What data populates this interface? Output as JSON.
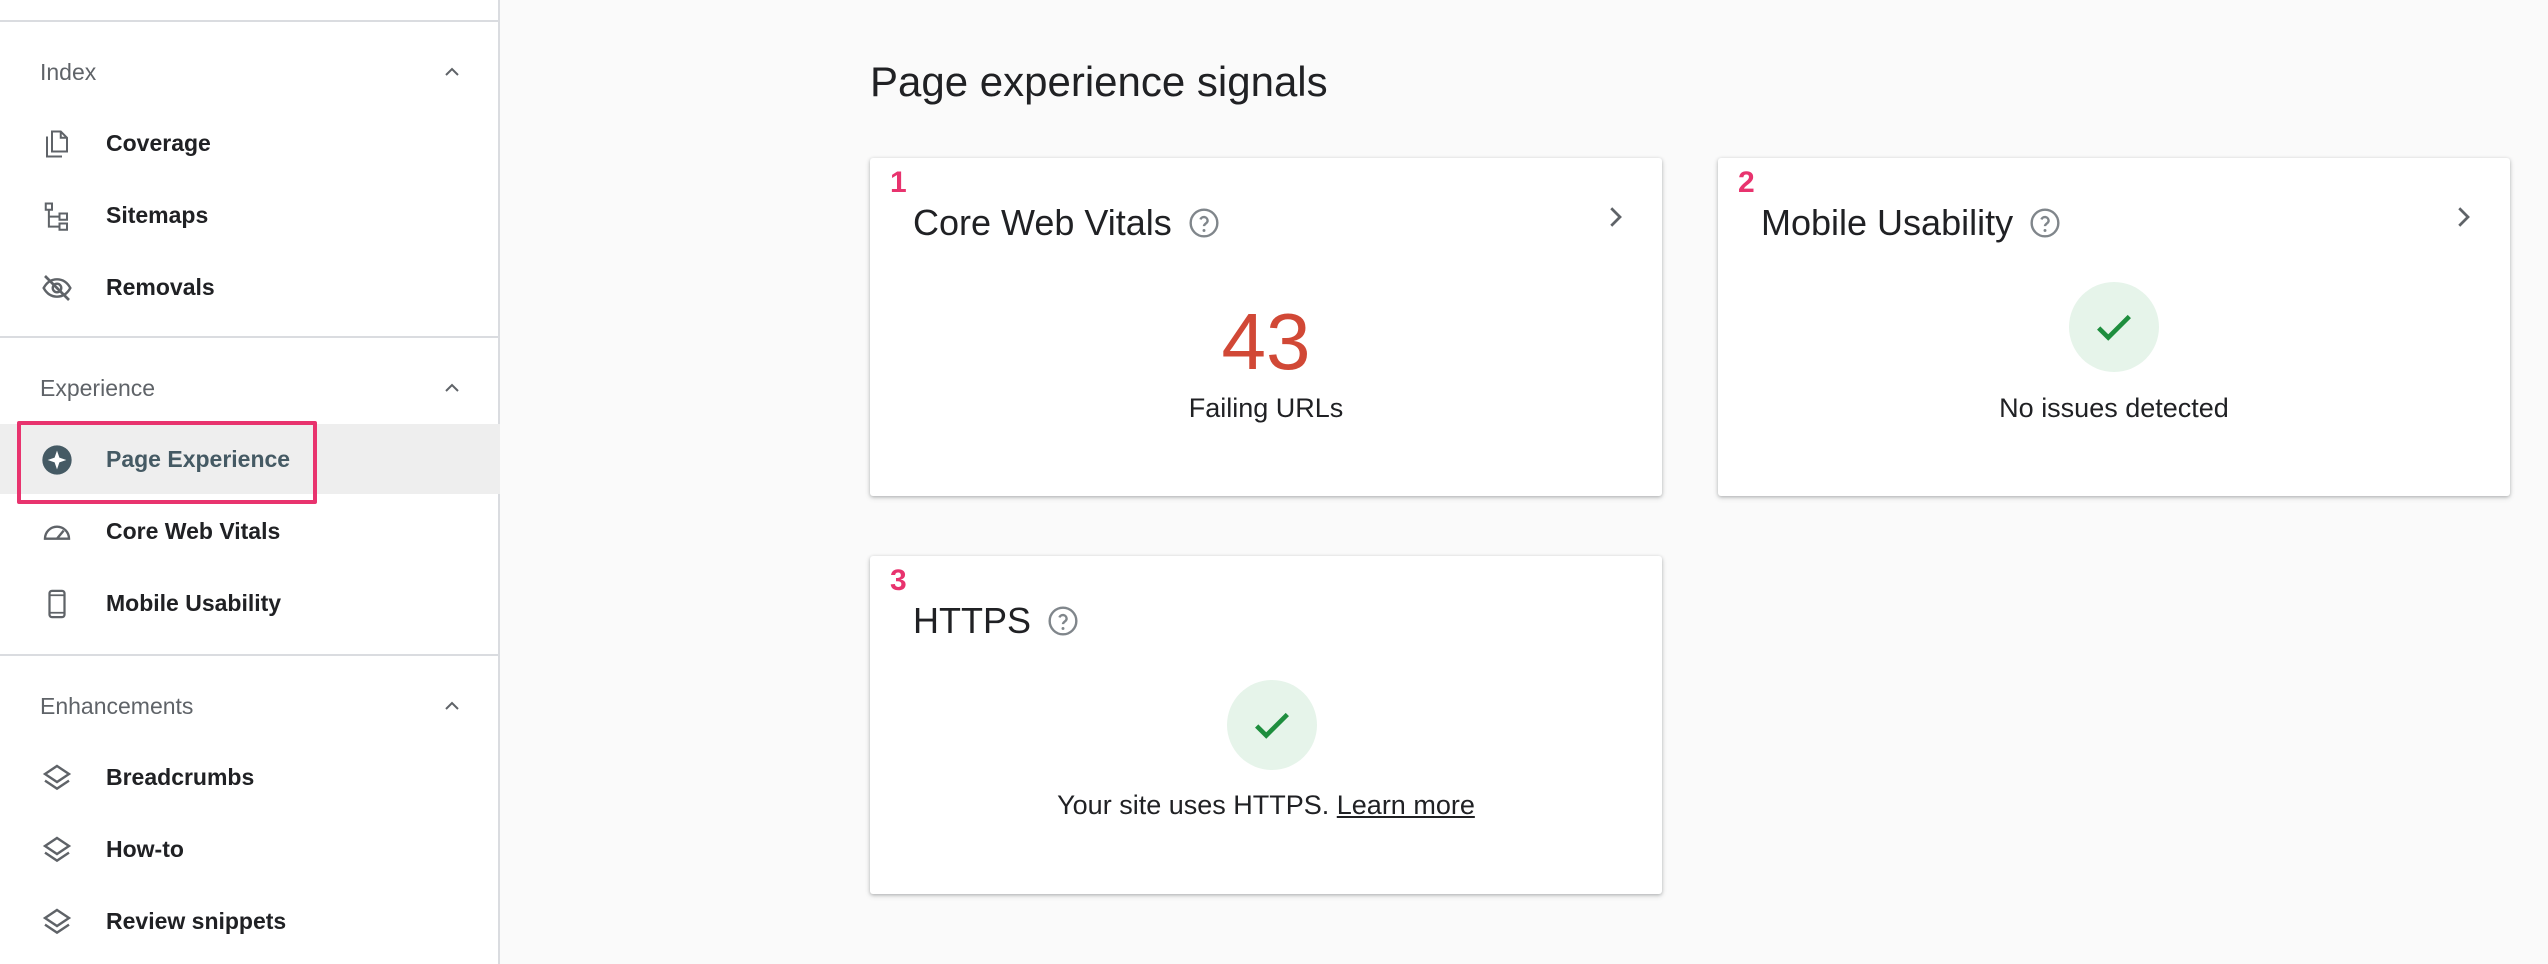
{
  "sidebar": {
    "sections": [
      {
        "label": "Index",
        "items": [
          {
            "label": "Coverage",
            "icon": "coverage-icon"
          },
          {
            "label": "Sitemaps",
            "icon": "sitemap-icon"
          },
          {
            "label": "Removals",
            "icon": "eye-off-icon"
          }
        ]
      },
      {
        "label": "Experience",
        "items": [
          {
            "label": "Page Experience",
            "icon": "page-experience-icon",
            "active": true
          },
          {
            "label": "Core Web Vitals",
            "icon": "speedometer-icon"
          },
          {
            "label": "Mobile Usability",
            "icon": "phone-icon"
          }
        ]
      },
      {
        "label": "Enhancements",
        "items": [
          {
            "label": "Breadcrumbs",
            "icon": "layers-icon"
          },
          {
            "label": "How-to",
            "icon": "layers-icon"
          },
          {
            "label": "Review snippets",
            "icon": "layers-icon"
          }
        ]
      }
    ]
  },
  "main": {
    "title": "Page experience signals",
    "cards": [
      {
        "number": "1",
        "title": "Core Web Vitals",
        "value": "43",
        "label": "Failing URLs"
      },
      {
        "number": "2",
        "title": "Mobile Usability",
        "label": "No issues detected"
      },
      {
        "number": "3",
        "title": "HTTPS",
        "label": "Your site uses HTTPS.",
        "link": "Learn more"
      }
    ]
  },
  "colors": {
    "accent_highlight": "#e8336e",
    "failing": "#d14836",
    "success": "#1e8e3e",
    "success_bg": "#e6f4ea"
  }
}
